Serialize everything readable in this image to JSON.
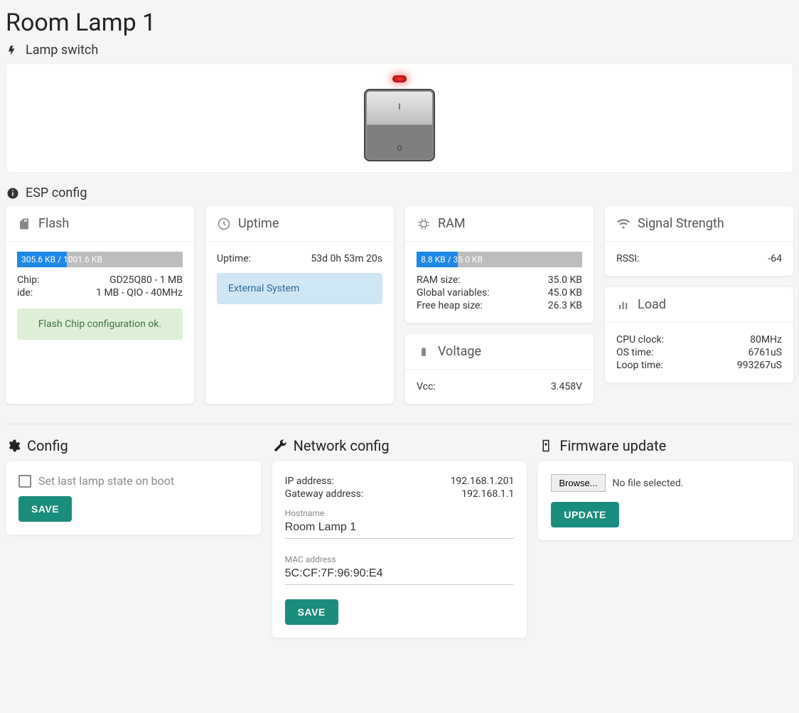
{
  "title": "Room Lamp 1",
  "sections": {
    "switch": {
      "label": "Lamp switch"
    },
    "esp": {
      "label": "ESP config"
    }
  },
  "flash": {
    "title": "Flash",
    "progress_label": "305.6 KB / 1001.6 KB",
    "progress_pct": 30,
    "rows": [
      {
        "k": "Chip:",
        "v": "GD25Q80 - 1 MB"
      },
      {
        "k": "ide:",
        "v": "1 MB - QIO - 40MHz"
      }
    ],
    "alert": "Flash Chip configuration ok."
  },
  "uptime": {
    "title": "Uptime",
    "rows": [
      {
        "k": "Uptime:",
        "v": "53d 0h 53m 20s"
      }
    ],
    "alert": "External System"
  },
  "ram": {
    "title": "RAM",
    "progress_label": "8.8 KB / 35.0 KB",
    "progress_pct": 25,
    "rows": [
      {
        "k": "RAM size:",
        "v": "35.0 KB"
      },
      {
        "k": "Global variables:",
        "v": "45.0 KB"
      },
      {
        "k": "Free heap size:",
        "v": "26.3 KB"
      }
    ]
  },
  "voltage": {
    "title": "Voltage",
    "rows": [
      {
        "k": "Vcc:",
        "v": "3.458V"
      }
    ]
  },
  "signal": {
    "title": "Signal Strength",
    "rows": [
      {
        "k": "RSSI:",
        "v": "-64"
      }
    ]
  },
  "load": {
    "title": "Load",
    "rows": [
      {
        "k": "CPU clock:",
        "v": "80MHz"
      },
      {
        "k": "OS time:",
        "v": "6761uS"
      },
      {
        "k": "Loop time:",
        "v": "993267uS"
      }
    ]
  },
  "config": {
    "title": "Config",
    "checkbox_label": "Set last lamp state on boot",
    "save": "SAVE"
  },
  "network": {
    "title": "Network config",
    "rows": [
      {
        "k": "IP address:",
        "v": "192.168.1.201"
      },
      {
        "k": "Gateway address:",
        "v": "192.168.1.1"
      }
    ],
    "hostname_label": "Hostname",
    "hostname_value": "Room Lamp 1",
    "mac_label": "MAC address",
    "mac_value": "5C:CF:7F:96:90:E4",
    "save": "SAVE"
  },
  "firmware": {
    "title": "Firmware update",
    "browse": "Browse...",
    "no_file": "No file selected.",
    "update": "UPDATE"
  }
}
